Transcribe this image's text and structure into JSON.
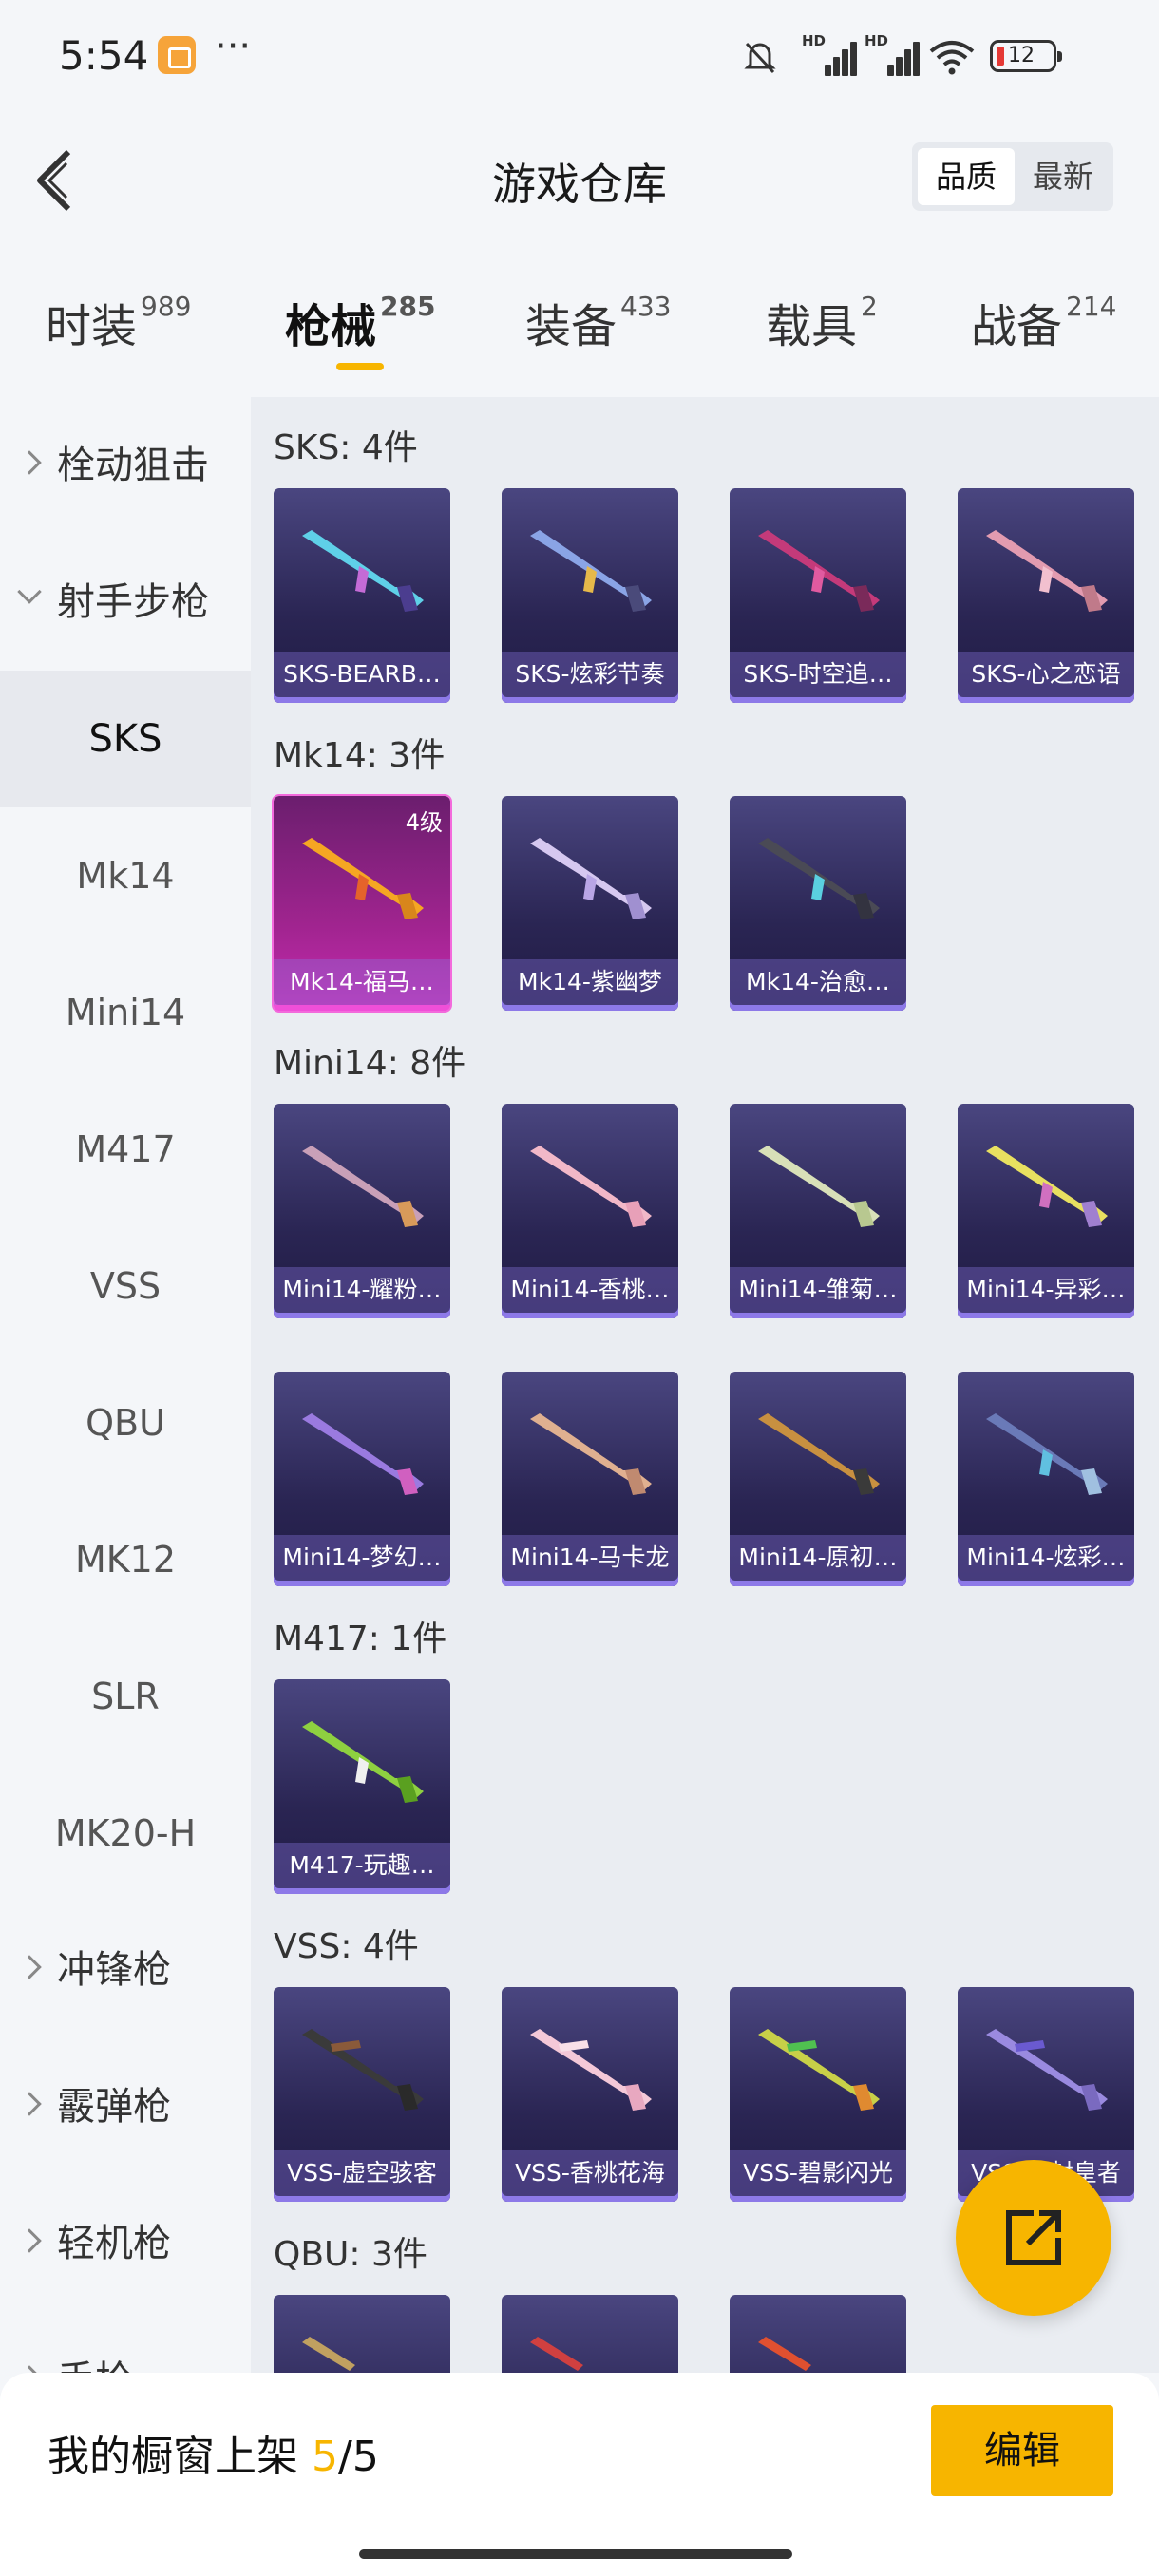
{
  "status": {
    "time": "5:54",
    "battery": "12"
  },
  "header": {
    "title": "游戏仓库",
    "sort": [
      "品质",
      "最新"
    ]
  },
  "tabs": [
    {
      "label": "时装",
      "count": "989"
    },
    {
      "label": "枪械",
      "count": "285"
    },
    {
      "label": "装备",
      "count": "433"
    },
    {
      "label": "载具",
      "count": "2"
    },
    {
      "label": "战备",
      "count": "214"
    }
  ],
  "sidebar": {
    "items": [
      "栓动狙击",
      "射手步枪",
      "SKS",
      "Mk14",
      "Mini14",
      "M417",
      "VSS",
      "QBU",
      "MK12",
      "SLR",
      "MK20-H",
      "冲锋枪",
      "霰弹枪",
      "轻机枪",
      "手枪"
    ]
  },
  "sections": [
    {
      "title": "SKS: 4件",
      "items": [
        "SKS-BEARB…",
        "SKS-炫彩节奏",
        "SKS-时空追…",
        "SKS-心之恋语"
      ]
    },
    {
      "title": "Mk14: 3件",
      "items": [
        "Mk14-福马…",
        "Mk14-紫幽梦",
        "Mk14-治愈…"
      ],
      "level": "4级"
    },
    {
      "title": "Mini14: 8件",
      "items": [
        "Mini14-耀粉…",
        "Mini14-香桃…",
        "Mini14-雏菊…",
        "Mini14-异彩…",
        "Mini14-梦幻…",
        "Mini14-马卡龙",
        "Mini14-原初…",
        "Mini14-炫彩…"
      ]
    },
    {
      "title": "M417: 1件",
      "items": [
        "M417-玩趣…"
      ]
    },
    {
      "title": "VSS: 4件",
      "items": [
        "VSS-虚空骇客",
        "VSS-香桃花海",
        "VSS-碧影闪光",
        "VSS-…封皇者"
      ]
    },
    {
      "title": "QBU: 3件",
      "items": []
    }
  ],
  "bottom": {
    "label_prefix": "我的橱窗上架 ",
    "current": "5",
    "sep_total": "/5",
    "edit": "编辑"
  }
}
